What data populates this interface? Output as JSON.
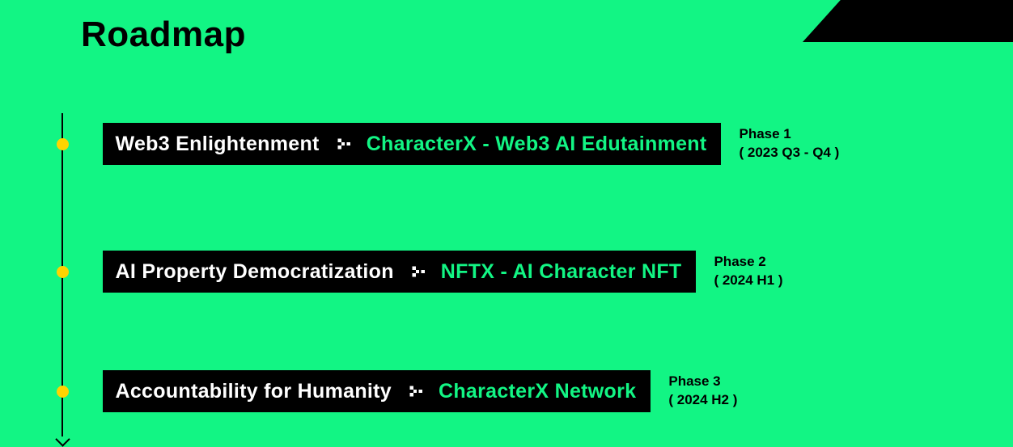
{
  "title": "Roadmap",
  "phases": [
    {
      "heading": "Web3 Enlightenment",
      "product": "CharacterX - Web3 AI Edutainment",
      "phase_label": "Phase 1",
      "timeframe": "( 2023 Q3 - Q4 )"
    },
    {
      "heading": "AI Property Democratization",
      "product": "NFTX - AI Character NFT",
      "phase_label": "Phase 2",
      "timeframe": "( 2024 H1 )"
    },
    {
      "heading": "Accountability for Humanity",
      "product": "CharacterX Network",
      "phase_label": "Phase 3",
      "timeframe": "( 2024 H2 )"
    }
  ]
}
